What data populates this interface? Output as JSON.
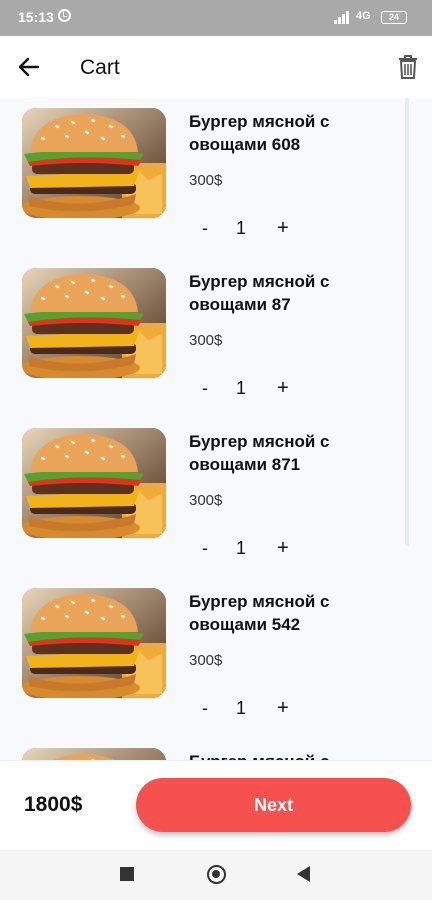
{
  "status_bar": {
    "time": "15:13",
    "network": "4G",
    "battery": "24",
    "icons": [
      "alarm-icon",
      "signal-icon",
      "battery-icon"
    ]
  },
  "app_bar": {
    "title": "Cart",
    "icons": [
      "back-arrow-icon",
      "trash-icon"
    ]
  },
  "cart": {
    "items": [
      {
        "name": "Бургер мясной с овощами 608",
        "price": "300$",
        "quantity": "1",
        "minus": "-",
        "plus": "+"
      },
      {
        "name": "Бургер мясной с овощами 87",
        "price": "300$",
        "quantity": "1",
        "minus": "-",
        "plus": "+"
      },
      {
        "name": "Бургер мясной с овощами 871",
        "price": "300$",
        "quantity": "1",
        "minus": "-",
        "plus": "+"
      },
      {
        "name": "Бургер мясной с овощами 542",
        "price": "300$",
        "quantity": "1",
        "minus": "-",
        "plus": "+"
      },
      {
        "name": "Бургер мясной с овощами",
        "price": "",
        "quantity": "",
        "minus": "",
        "plus": ""
      }
    ]
  },
  "footer": {
    "total": "1800$",
    "next_label": "Next"
  },
  "colors": {
    "accent": "#f6504f",
    "status_bar": "#a9a9a9",
    "list_background": "#f7f9fb"
  },
  "nav_bar": {
    "icons": [
      "recent-apps-icon",
      "home-icon",
      "back-icon"
    ]
  }
}
